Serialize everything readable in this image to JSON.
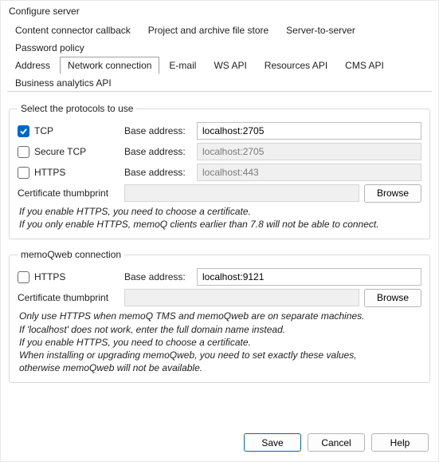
{
  "window": {
    "title": "Configure server"
  },
  "tabs": {
    "row1": [
      "Content connector callback",
      "Project and archive file store",
      "Server-to-server",
      "Password policy"
    ],
    "row2": [
      "Address",
      "Network connection",
      "E-mail",
      "WS API",
      "Resources API",
      "CMS API",
      "Business analytics API"
    ],
    "active": "Network connection"
  },
  "group1": {
    "legend": "Select the protocols to use",
    "rows": [
      {
        "name": "tcp",
        "label": "TCP",
        "checked": true,
        "addr_label": "Base address:",
        "addr_value": "localhost:2705",
        "enabled": true
      },
      {
        "name": "secure-tcp",
        "label": "Secure TCP",
        "checked": false,
        "addr_label": "Base address:",
        "addr_value": "localhost:2705",
        "enabled": false
      },
      {
        "name": "https",
        "label": "HTTPS",
        "checked": false,
        "addr_label": "Base address:",
        "addr_value": "localhost:443",
        "enabled": false
      }
    ],
    "cert_label": "Certificate thumbprint",
    "cert_value": "",
    "browse_label": "Browse",
    "notes": [
      "If you enable HTTPS, you need to choose a certificate.",
      "If you only enable HTTPS, memoQ clients earlier than 7.8 will not be able to connect."
    ]
  },
  "group2": {
    "legend": "memoQweb connection",
    "row": {
      "name": "mqweb-https",
      "label": "HTTPS",
      "checked": false,
      "addr_label": "Base address:",
      "addr_value": "localhost:9121",
      "enabled": true
    },
    "cert_label": "Certificate thumbprint",
    "cert_value": "",
    "browse_label": "Browse",
    "notes": [
      "Only use HTTPS when memoQ TMS and memoQweb are on separate machines.",
      "If 'localhost' does not work, enter the full domain name instead.",
      "If you enable HTTPS, you need to choose a certificate.",
      "When installing or upgrading memoQweb, you need to set exactly these values,",
      "otherwise memoQweb will not be available."
    ]
  },
  "footer": {
    "save": "Save",
    "cancel": "Cancel",
    "help": "Help"
  }
}
